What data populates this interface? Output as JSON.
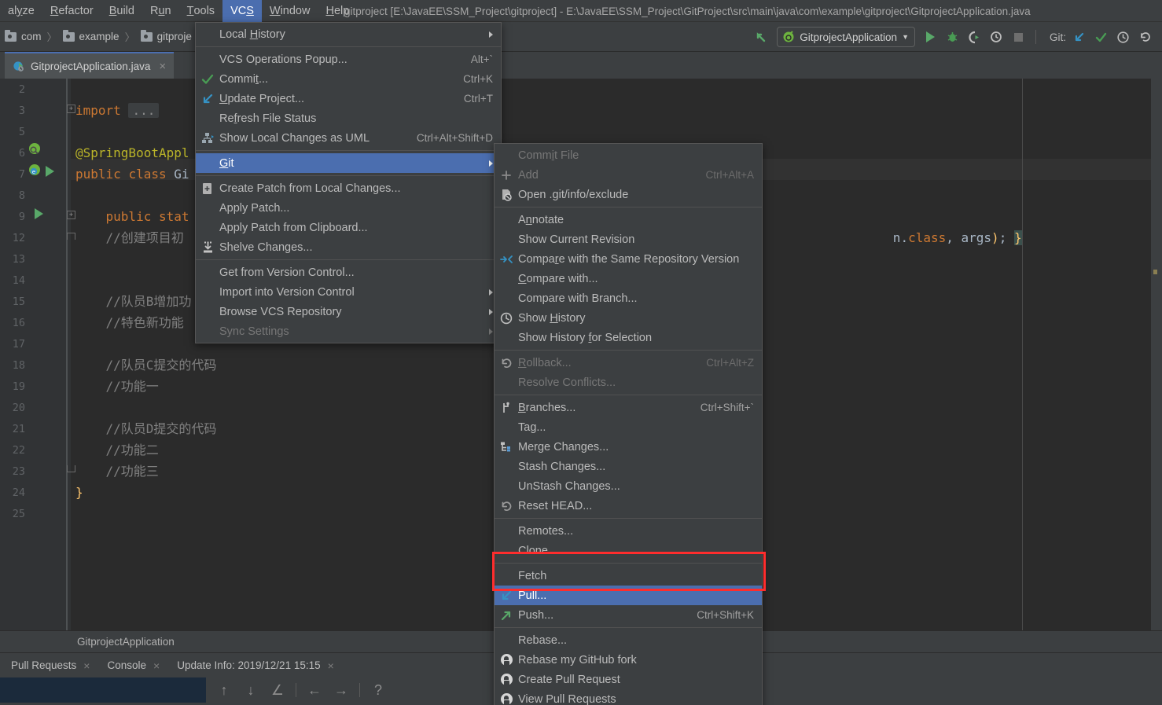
{
  "menubar": {
    "items": [
      {
        "label": "alyze",
        "underline": "y",
        "active": false
      },
      {
        "label": "Refactor",
        "underline": "R",
        "active": false
      },
      {
        "label": "Build",
        "underline": "B",
        "active": false
      },
      {
        "label": "Run",
        "underline": "u",
        "active": false
      },
      {
        "label": "Tools",
        "underline": "T",
        "active": false
      },
      {
        "label": "VCS",
        "underline": "S",
        "active": true
      },
      {
        "label": "Window",
        "underline": "W",
        "active": false
      },
      {
        "label": "Help",
        "underline": "H",
        "active": false
      }
    ],
    "window_title": "gitproject [E:\\JavaEE\\SSM_Project\\gitproject] - E:\\JavaEE\\SSM_Project\\GitProject\\src\\main\\java\\com\\example\\gitproject\\GitprojectApplication.java"
  },
  "navbar": {
    "crumbs": [
      "com",
      "example",
      "gitproje"
    ],
    "separator": "〉"
  },
  "toolbar": {
    "run_config": "GitprojectApplication",
    "git_label": "Git:",
    "icons": [
      "back-arrow-icon",
      "run-icon",
      "debug-icon",
      "run-coverage-icon",
      "profile-icon",
      "stop-icon",
      "update-project-icon",
      "commit-icon",
      "history-icon",
      "rollback-icon"
    ]
  },
  "editor_tab": {
    "title": "GitprojectApplication.java",
    "close": "×"
  },
  "editor": {
    "lines": [
      {
        "num": "2",
        "html": ""
      },
      {
        "num": "3",
        "html": "<span class=\"k\">import</span> <span class=\"ellipsis\">...</span>"
      },
      {
        "num": "5",
        "html": ""
      },
      {
        "num": "6",
        "html": "<span class=\"ann\">@SpringBootAppl</span>"
      },
      {
        "num": "7",
        "html": "<span class=\"k\">public</span> <span class=\"k\">class</span> <span class=\"cls\">Gi</span>"
      },
      {
        "num": "8",
        "html": ""
      },
      {
        "num": "9",
        "html": "    <span class=\"k\">public</span> <span class=\"k\">stat</span>"
      },
      {
        "num": "12",
        "html": "    <span class=\"cmt\">//创建项目初</span>"
      },
      {
        "num": "13",
        "html": ""
      },
      {
        "num": "14",
        "html": ""
      },
      {
        "num": "15",
        "html": "    <span class=\"cmt\">//队员B增加功</span>"
      },
      {
        "num": "16",
        "html": "    <span class=\"cmt\">//特色新功能</span>"
      },
      {
        "num": "17",
        "html": ""
      },
      {
        "num": "18",
        "html": "    <span class=\"cmt\">//队员C提交的代码</span>"
      },
      {
        "num": "19",
        "html": "    <span class=\"cmt\">//功能一</span>"
      },
      {
        "num": "20",
        "html": ""
      },
      {
        "num": "21",
        "html": "    <span class=\"cmt\">//队员D提交的代码</span>"
      },
      {
        "num": "22",
        "html": "    <span class=\"cmt\">//功能二</span>"
      },
      {
        "num": "23",
        "html": "    <span class=\"cmt\">//功能三</span>"
      },
      {
        "num": "24",
        "html": "<span class=\"ylw\">}</span>"
      },
      {
        "num": "25",
        "html": ""
      }
    ],
    "right_fragment": "n.class, args); }",
    "breadcrumb": "GitprojectApplication"
  },
  "vcs_menu": {
    "items": [
      {
        "label": "Local History",
        "icon": "",
        "accel": "",
        "submenu": true,
        "disabled": false,
        "selected": false,
        "underline": "H"
      },
      {
        "separator": true
      },
      {
        "label": "VCS Operations Popup...",
        "icon": "",
        "accel": "Alt+`",
        "submenu": false,
        "disabled": false,
        "selected": false
      },
      {
        "label": "Commit...",
        "icon": "check-icon",
        "accel": "Ctrl+K",
        "submenu": false,
        "disabled": false,
        "selected": false,
        "underline": "t"
      },
      {
        "label": "Update Project...",
        "icon": "arrow-down-left-icon",
        "accel": "Ctrl+T",
        "submenu": false,
        "disabled": false,
        "selected": false,
        "underline": "U"
      },
      {
        "label": "Refresh File Status",
        "icon": "",
        "accel": "",
        "submenu": false,
        "disabled": false,
        "selected": false,
        "underline": "f"
      },
      {
        "label": "Show Local Changes as UML",
        "icon": "uml-icon",
        "accel": "Ctrl+Alt+Shift+D",
        "submenu": false,
        "disabled": false,
        "selected": false
      },
      {
        "separator": true
      },
      {
        "label": "Git",
        "icon": "",
        "accel": "",
        "submenu": true,
        "disabled": false,
        "selected": true,
        "underline": "G"
      },
      {
        "separator": true
      },
      {
        "label": "Create Patch from Local Changes...",
        "icon": "patch-icon",
        "accel": "",
        "submenu": false,
        "disabled": false,
        "selected": false
      },
      {
        "label": "Apply Patch...",
        "icon": "",
        "accel": "",
        "submenu": false,
        "disabled": false,
        "selected": false
      },
      {
        "label": "Apply Patch from Clipboard...",
        "icon": "",
        "accel": "",
        "submenu": false,
        "disabled": false,
        "selected": false
      },
      {
        "label": "Shelve Changes...",
        "icon": "shelve-icon",
        "accel": "",
        "submenu": false,
        "disabled": false,
        "selected": false
      },
      {
        "separator": true
      },
      {
        "label": "Get from Version Control...",
        "icon": "",
        "accel": "",
        "submenu": false,
        "disabled": false,
        "selected": false
      },
      {
        "label": "Import into Version Control",
        "icon": "",
        "accel": "",
        "submenu": true,
        "disabled": false,
        "selected": false
      },
      {
        "label": "Browse VCS Repository",
        "icon": "",
        "accel": "",
        "submenu": true,
        "disabled": false,
        "selected": false
      },
      {
        "label": "Sync Settings",
        "icon": "",
        "accel": "",
        "submenu": true,
        "disabled": true,
        "selected": false
      }
    ]
  },
  "git_menu": {
    "items": [
      {
        "label": "Commit File",
        "icon": "",
        "accel": "",
        "disabled": true,
        "selected": false,
        "underline": "i"
      },
      {
        "label": "Add",
        "icon": "plus-icon",
        "accel": "Ctrl+Alt+A",
        "disabled": true,
        "selected": false
      },
      {
        "label": "Open .git/info/exclude",
        "icon": "exclude-file-icon",
        "accel": "",
        "disabled": false,
        "selected": false
      },
      {
        "separator": true
      },
      {
        "label": "Annotate",
        "icon": "",
        "accel": "",
        "disabled": false,
        "selected": false,
        "underline": "n"
      },
      {
        "label": "Show Current Revision",
        "icon": "",
        "accel": "",
        "disabled": false,
        "selected": false
      },
      {
        "label": "Compare with the Same Repository Version",
        "icon": "compare-icon",
        "accel": "",
        "disabled": false,
        "selected": false,
        "underline": "r"
      },
      {
        "label": "Compare with...",
        "icon": "",
        "accel": "",
        "disabled": false,
        "selected": false,
        "underline": "C"
      },
      {
        "label": "Compare with Branch...",
        "icon": "",
        "accel": "",
        "disabled": false,
        "selected": false
      },
      {
        "label": "Show History",
        "icon": "clock-icon",
        "accel": "",
        "disabled": false,
        "selected": false,
        "underline": "H"
      },
      {
        "label": "Show History for Selection",
        "icon": "",
        "accel": "",
        "disabled": false,
        "selected": false,
        "underline": "f"
      },
      {
        "separator": true
      },
      {
        "label": "Rollback...",
        "icon": "undo-icon",
        "accel": "Ctrl+Alt+Z",
        "disabled": true,
        "selected": false,
        "underline": "R"
      },
      {
        "label": "Resolve Conflicts...",
        "icon": "",
        "accel": "",
        "disabled": true,
        "selected": false
      },
      {
        "separator": true
      },
      {
        "label": "Branches...",
        "icon": "branch-icon",
        "accel": "Ctrl+Shift+`",
        "disabled": false,
        "selected": false,
        "underline": "B"
      },
      {
        "label": "Tag...",
        "icon": "",
        "accel": "",
        "disabled": false,
        "selected": false
      },
      {
        "label": "Merge Changes...",
        "icon": "merge-icon",
        "accel": "",
        "disabled": false,
        "selected": false
      },
      {
        "label": "Stash Changes...",
        "icon": "",
        "accel": "",
        "disabled": false,
        "selected": false
      },
      {
        "label": "UnStash Changes...",
        "icon": "",
        "accel": "",
        "disabled": false,
        "selected": false
      },
      {
        "label": "Reset HEAD...",
        "icon": "undo-icon",
        "accel": "",
        "disabled": false,
        "selected": false
      },
      {
        "separator": true
      },
      {
        "label": "Remotes...",
        "icon": "",
        "accel": "",
        "disabled": false,
        "selected": false
      },
      {
        "label": "Clone...",
        "icon": "",
        "accel": "",
        "disabled": false,
        "selected": false
      },
      {
        "separator": true
      },
      {
        "label": "Fetch",
        "icon": "",
        "accel": "",
        "disabled": false,
        "selected": false
      },
      {
        "label": "Pull...",
        "icon": "arrow-down-left-icon",
        "accel": "",
        "disabled": false,
        "selected": true
      },
      {
        "label": "Push...",
        "icon": "arrow-up-right-icon",
        "accel": "Ctrl+Shift+K",
        "disabled": false,
        "selected": false
      },
      {
        "separator": true
      },
      {
        "label": "Rebase...",
        "icon": "",
        "accel": "",
        "disabled": false,
        "selected": false
      },
      {
        "label": "Rebase my GitHub fork",
        "icon": "github-icon",
        "accel": "",
        "disabled": false,
        "selected": false
      },
      {
        "label": "Create Pull Request",
        "icon": "github-icon",
        "accel": "",
        "disabled": false,
        "selected": false
      },
      {
        "label": "View Pull Requests",
        "icon": "github-icon",
        "accel": "",
        "disabled": false,
        "selected": false
      }
    ]
  },
  "tool_window_tabs": [
    {
      "label": "Pull Requests",
      "close": "×"
    },
    {
      "label": "Console",
      "close": "×"
    },
    {
      "label": "Update Info: 2019/12/21 15:15",
      "close": "×"
    }
  ],
  "bottom_tools": [
    {
      "name": "prev-occurrence-icon",
      "glyph": "↑"
    },
    {
      "name": "next-occurrence-icon",
      "glyph": "↓"
    },
    {
      "name": "edit-source-icon",
      "glyph": "∠"
    },
    {
      "name": "divider",
      "glyph": ""
    },
    {
      "name": "back-icon",
      "glyph": "←"
    },
    {
      "name": "forward-icon",
      "glyph": "→"
    },
    {
      "name": "divider",
      "glyph": ""
    },
    {
      "name": "help-icon",
      "glyph": "?"
    }
  ],
  "colors": {
    "accent_selection": "#4b6eaf",
    "annotation_red": "#ff2d2d",
    "menu_bg": "#3c3f41",
    "editor_bg": "#2b2b2b",
    "progress_panel": "#1b2a3b"
  }
}
